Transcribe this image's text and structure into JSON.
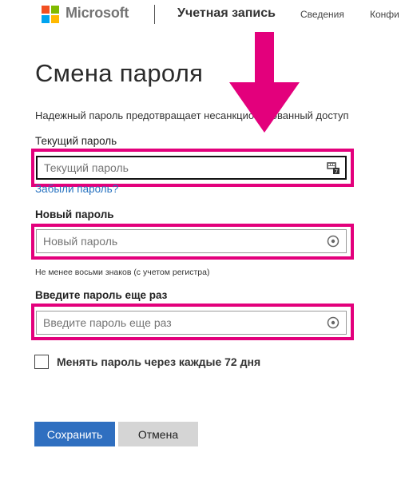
{
  "header": {
    "brand": "Microsoft",
    "account": "Учетная запись",
    "nav": [
      "Сведения",
      "Конфи"
    ]
  },
  "page": {
    "title": "Смена пароля",
    "intro": "Надежный пароль предотвращает несанкционированный доступ"
  },
  "form": {
    "current": {
      "label": "Текущий пароль",
      "placeholder": "Текущий пароль"
    },
    "forgot_link": "Забыли пароль?",
    "new": {
      "label": "Новый пароль",
      "placeholder": "Новый пароль",
      "hint": "Не менее восьми знаков (с учетом регистра)"
    },
    "confirm": {
      "label": "Введите пароль еще раз",
      "placeholder": "Введите пароль еще раз"
    },
    "expire_checkbox": {
      "label": "Менять пароль через каждые 72 дня",
      "checked": false
    }
  },
  "buttons": {
    "save": "Сохранить",
    "cancel": "Отмена"
  },
  "colors": {
    "highlight": "#e3007c",
    "primary": "#2f6fc0",
    "link": "#2672c0",
    "cancel_bg": "#d5d5d5"
  }
}
